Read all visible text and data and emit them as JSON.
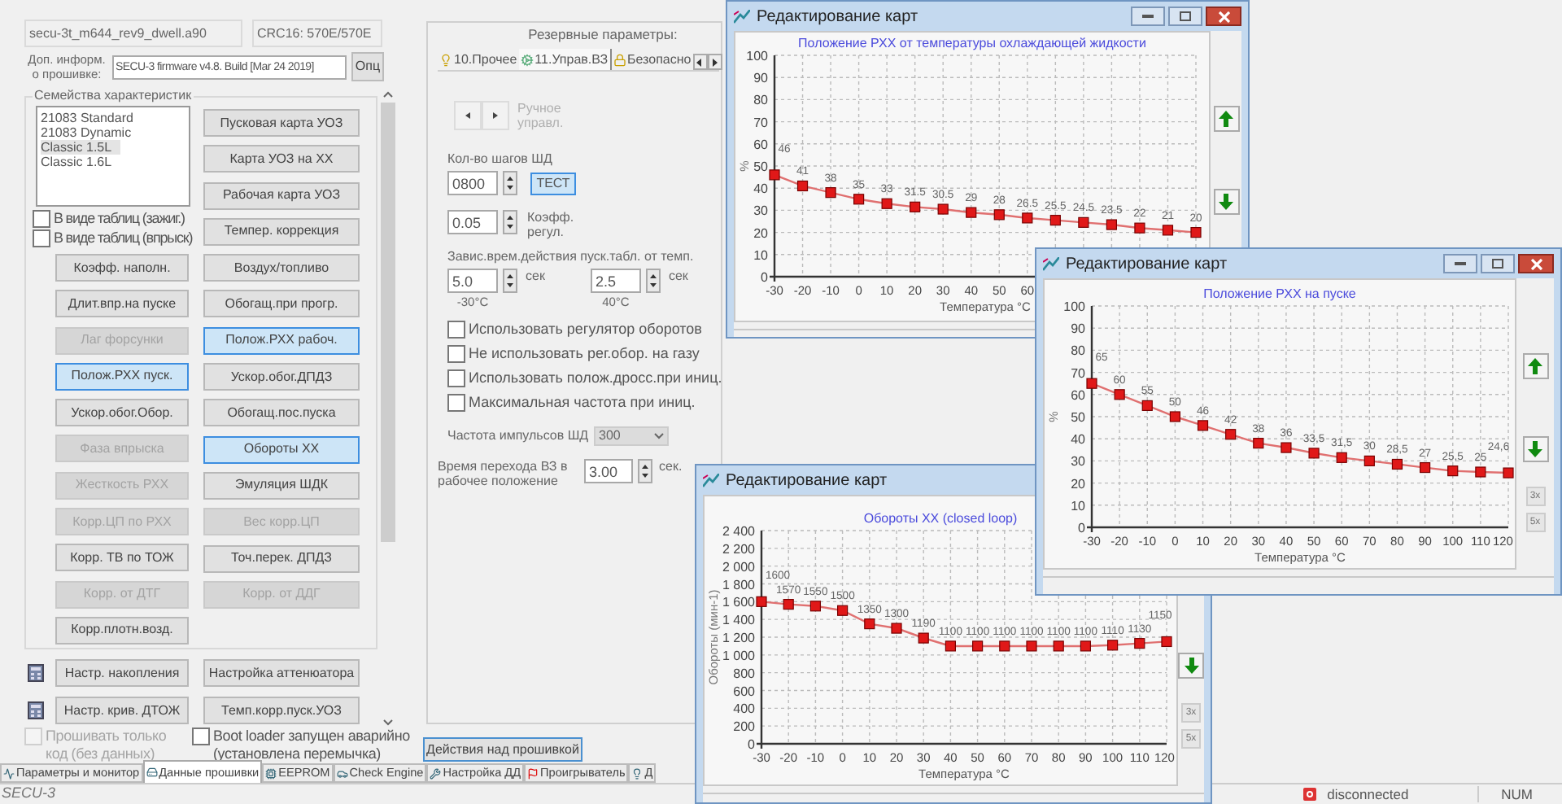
{
  "file_field": {
    "value": "secu-3t_m644_rev9_dwell.a90"
  },
  "crc_field": {
    "value": "CRC16: 570E/570E"
  },
  "fw_info": {
    "label": "Доп. информ. о прошивке:",
    "value": "SECU-3 firmware v4.8. Build [Mar 24 2019]",
    "button": "Опц"
  },
  "family": {
    "title": "Семейства характеристик",
    "list": [
      {
        "label": "21083 Standard",
        "selected": false
      },
      {
        "label": "21083 Dynamic",
        "selected": false
      },
      {
        "label": "Classic 1.5L",
        "selected": true
      },
      {
        "label": "Classic 1.6L",
        "selected": false
      }
    ],
    "checkboxes": [
      {
        "label": "В виде таблиц (зажиг.)",
        "checked": false
      },
      {
        "label": "В виде таблиц (впрыск)",
        "checked": false
      }
    ],
    "left_buttons": [
      {
        "label": "Коэфф. наполн.",
        "selected": false,
        "disabled": false
      },
      {
        "label": "Длит.впр.на пуске",
        "selected": false,
        "disabled": false
      },
      {
        "label": "Лаг форсунки",
        "selected": false,
        "disabled": true
      },
      {
        "label": "Полож.РХХ пуск.",
        "selected": true,
        "disabled": false
      },
      {
        "label": "Ускор.обог.Обор.",
        "selected": false,
        "disabled": false
      },
      {
        "label": "Фаза впрыска",
        "selected": false,
        "disabled": true
      },
      {
        "label": "Жесткость РХХ",
        "selected": false,
        "disabled": true
      },
      {
        "label": "Корр.ЦП по РХХ",
        "selected": false,
        "disabled": true
      },
      {
        "label": "Корр. ТВ по ТОЖ",
        "selected": false,
        "disabled": false
      },
      {
        "label": "Корр. от ДТГ",
        "selected": false,
        "disabled": true
      },
      {
        "label": "Корр.плотн.возд.",
        "selected": false,
        "disabled": false
      }
    ],
    "right_buttons": [
      {
        "label": "Пусковая карта УОЗ",
        "selected": false,
        "disabled": false
      },
      {
        "label": "Карта УОЗ на ХХ",
        "selected": false,
        "disabled": false
      },
      {
        "label": "Рабочая карта УОЗ",
        "selected": false,
        "disabled": false
      },
      {
        "label": "Темпер. коррекция",
        "selected": false,
        "disabled": false
      },
      {
        "label": "Воздух/топливо",
        "selected": false,
        "disabled": false
      },
      {
        "label": "Обогащ.при прогр.",
        "selected": false,
        "disabled": false
      },
      {
        "label": "Полож.РХХ рабоч.",
        "selected": true,
        "disabled": false
      },
      {
        "label": "Ускор.обог.ДПДЗ",
        "selected": false,
        "disabled": false
      },
      {
        "label": "Обогащ.пос.пуска",
        "selected": false,
        "disabled": false
      },
      {
        "label": "Обороты ХХ",
        "selected": true,
        "disabled": false
      },
      {
        "label": "Эмуляция ШДК",
        "selected": false,
        "disabled": false
      },
      {
        "label": "Вес корр.ЦП",
        "selected": false,
        "disabled": true
      },
      {
        "label": "Точ.перек. ДПДЗ",
        "selected": false,
        "disabled": false
      },
      {
        "label": "Корр. от ДДГ",
        "selected": false,
        "disabled": true
      }
    ]
  },
  "extra_rows": [
    {
      "buttons": [
        {
          "label": "Настр. накопления",
          "selected": false,
          "disabled": false
        },
        {
          "label": "Настройка аттенюатора",
          "selected": false,
          "disabled": false
        }
      ]
    },
    {
      "buttons": [
        {
          "label": "Настр. крив. ДТОЖ",
          "selected": false,
          "disabled": false
        },
        {
          "label": "Темп.корр.пуск.УОЗ",
          "selected": false,
          "disabled": false
        }
      ]
    }
  ],
  "bottom_checkboxes": [
    {
      "label": "Прошивать только код (без данных)",
      "checked": false,
      "disabled": true
    },
    {
      "label": "Boot loader запущен аварийно (установлена перемычка)",
      "checked": false,
      "disabled": false
    }
  ],
  "reserve": {
    "title": "Резервные параметры:",
    "tabs": [
      {
        "label": "10.Прочее",
        "selected": false
      },
      {
        "label": "11.Управ.ВЗ",
        "selected": true
      },
      {
        "label": "Безопасно",
        "selected": false
      }
    ],
    "manual": {
      "label": "Ручное управл.",
      "disabled": true
    },
    "steps": {
      "label": "Кол-во шагов ШД",
      "value": "0800",
      "button": "ТЕСТ"
    },
    "coef": {
      "value": "0.05",
      "label": "Коэфф. регул."
    },
    "dep_label": "Завис.врем.действия пуск.табл. от темп.",
    "times": [
      {
        "value": "5.0",
        "unit": "сек",
        "temp": "-30°C"
      },
      {
        "value": "2.5",
        "unit": "сек",
        "temp": "40°C"
      }
    ],
    "checkboxes": [
      {
        "label": "Использовать регулятор оборотов",
        "checked": false
      },
      {
        "label": "Не использовать рег.обор. на газу",
        "checked": false
      },
      {
        "label": "Использовать полож.дросс.при иниц.",
        "checked": false
      },
      {
        "label": "Максимальная частота при иниц.",
        "checked": false
      }
    ],
    "freq": {
      "label": "Частота импульсов ШД",
      "value": "300"
    },
    "transition": {
      "label": "Время перехода ВЗ в рабочее положение",
      "value": "3.00",
      "unit": "сек."
    }
  },
  "action_button": "Действия над прошивкой",
  "tabs": [
    {
      "label": "Параметры и монитор",
      "selected": false
    },
    {
      "label": "Данные прошивки",
      "selected": true
    },
    {
      "label": "EEPROM",
      "selected": false
    },
    {
      "label": "Check Engine",
      "selected": false
    },
    {
      "label": "Настройка ДД",
      "selected": false
    },
    {
      "label": "Проигрыватель",
      "selected": false
    },
    {
      "label": "Д",
      "selected": false
    }
  ],
  "status_bar": {
    "app": "SECU-3",
    "connection": "disconnected",
    "num": "NUM"
  },
  "windows": [
    {
      "title": "Редактирование карт",
      "buttons": [
        {
          "kind": "up"
        },
        {
          "kind": "down"
        }
      ],
      "chart_data": {
        "type": "line",
        "grid": true,
        "marker": "square",
        "title": "Положение РХХ от температуры охлаждающей жидкости",
        "xlabel": "Температура °С",
        "ylabel": "%",
        "x": [
          -30,
          -20,
          -10,
          0,
          10,
          20,
          30,
          40,
          50,
          60,
          70,
          80,
          90,
          100,
          110,
          120
        ],
        "values": [
          46,
          41,
          38,
          35,
          33,
          31.5,
          30.5,
          29,
          28,
          26.5,
          25.5,
          24.5,
          23.5,
          22,
          21,
          20
        ],
        "value_labels": [
          "46",
          "41",
          "38",
          "35",
          "33",
          "31.5",
          "30.5",
          "29",
          "28",
          "26.5",
          "25.5",
          "24.5",
          "23.5",
          "22",
          "21",
          "20"
        ],
        "xlim": [
          -30,
          120
        ],
        "ylim": [
          0,
          100
        ],
        "xticks": [
          -30,
          -20,
          -10,
          0,
          10,
          20,
          30,
          40,
          50,
          60
        ],
        "yticks": [
          0,
          10,
          20,
          30,
          40,
          50,
          60,
          70,
          80,
          90,
          100
        ]
      }
    },
    {
      "title": "Редактирование карт",
      "buttons": [
        {
          "kind": "down"
        },
        {
          "kind": "zoom",
          "label": "3x"
        },
        {
          "kind": "zoom",
          "label": "5x"
        }
      ],
      "chart_data": {
        "type": "line",
        "grid": true,
        "marker": "square",
        "title": "Обороты ХХ (closed loop)",
        "xlabel": "Температура °С",
        "ylabel": "Обороты (мин-1)",
        "x": [
          -30,
          -20,
          -10,
          0,
          10,
          20,
          30,
          40,
          50,
          60,
          70,
          80,
          90,
          100,
          110,
          120
        ],
        "values": [
          1600,
          1570,
          1550,
          1500,
          1350,
          1300,
          1190,
          1100,
          1100,
          1100,
          1100,
          1100,
          1100,
          1110,
          1130,
          1150
        ],
        "value_labels": [
          "1600",
          "1570",
          "1550",
          "1500",
          "1350",
          "1300",
          "1190",
          "1100",
          "1100",
          "1100",
          "1100",
          "1100",
          "1100",
          "1110",
          "1130",
          "1150"
        ],
        "xlim": [
          -30,
          120
        ],
        "ylim": [
          0,
          2400
        ],
        "xticks": [
          -30,
          -20,
          -10,
          0,
          10,
          20,
          30,
          40,
          50,
          60,
          70,
          80,
          90,
          100,
          110,
          120
        ],
        "yticks": [
          0,
          {
            "value": 200,
            "label": "200"
          },
          {
            "value": 400,
            "label": "400"
          },
          {
            "value": 600,
            "label": "600"
          },
          {
            "value": 800,
            "label": "800"
          },
          {
            "value": 1000,
            "label": "1 000"
          },
          {
            "value": 1200,
            "label": "1 200"
          },
          {
            "value": 1400,
            "label": "1 400"
          },
          {
            "value": 1600,
            "label": "1 600"
          },
          {
            "value": 1800,
            "label": "1 800"
          },
          {
            "value": 2000,
            "label": "2 000"
          },
          {
            "value": 2200,
            "label": "2 200"
          },
          {
            "value": 2400,
            "label": "2 400"
          }
        ]
      }
    },
    {
      "title": "Редактирование карт",
      "buttons": [
        {
          "kind": "up"
        },
        {
          "kind": "down"
        },
        {
          "kind": "zoom",
          "label": "3x"
        },
        {
          "kind": "zoom",
          "label": "5x"
        }
      ],
      "chart_data": {
        "type": "line",
        "grid": true,
        "marker": "square",
        "title": "Положение РХХ на пуске",
        "xlabel": "Температура °С",
        "ylabel": "%",
        "x": [
          -30,
          -20,
          -10,
          0,
          10,
          20,
          30,
          40,
          50,
          60,
          70,
          80,
          90,
          100,
          110,
          120
        ],
        "values": [
          65,
          60,
          55,
          50,
          46,
          42,
          38,
          36,
          33.5,
          31.5,
          30,
          28.5,
          27,
          25.5,
          25,
          24.6
        ],
        "value_labels": [
          "65",
          "60",
          "55",
          "50",
          "46",
          "42",
          "38",
          "36",
          "33,5",
          "31,5",
          "30",
          "28,5",
          "27",
          "25,5",
          "25",
          "24,6"
        ],
        "xlim": [
          -30,
          120
        ],
        "ylim": [
          0,
          100
        ],
        "xticks": [
          -30,
          -20,
          -10,
          0,
          10,
          20,
          30,
          40,
          50,
          60,
          70,
          80,
          90,
          100,
          110,
          120
        ],
        "yticks": [
          0,
          10,
          20,
          30,
          40,
          50,
          60,
          70,
          80,
          90,
          100
        ]
      }
    }
  ]
}
